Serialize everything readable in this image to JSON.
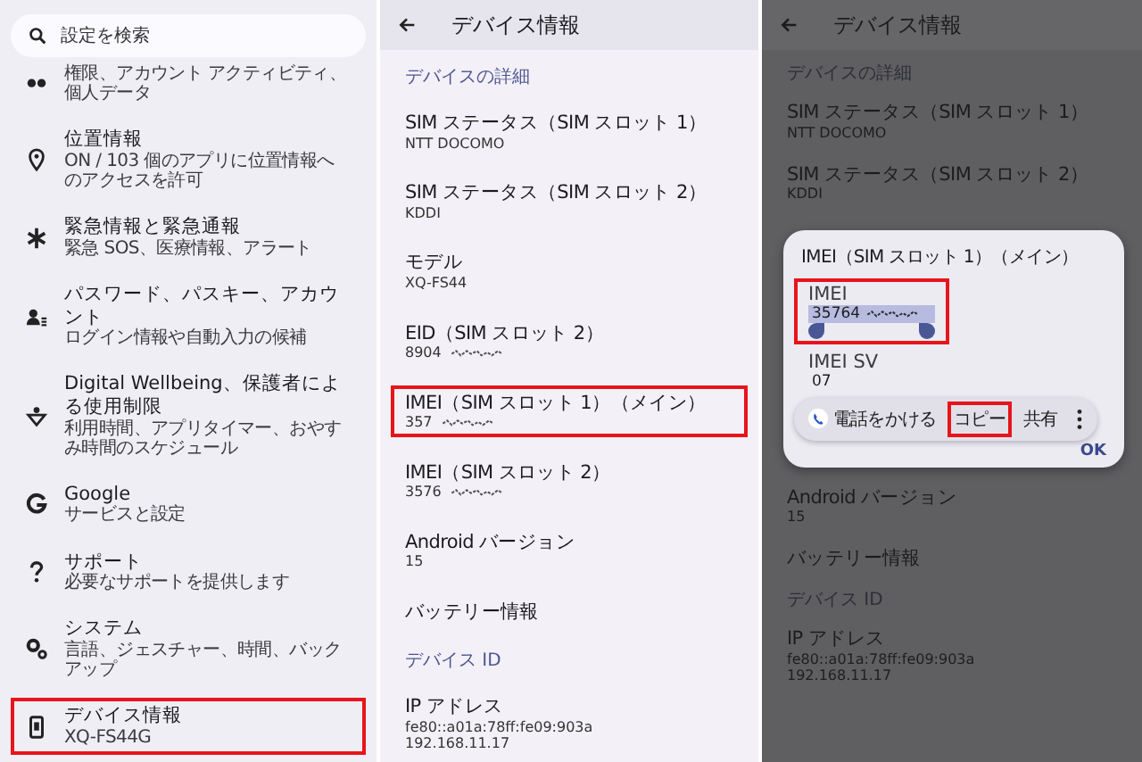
{
  "settings_panel": {
    "search": {
      "placeholder": "設定を検索"
    },
    "items": [
      {
        "subtitle": "権限、アカウント アクティビティ、個人データ",
        "highlighted": false
      },
      {
        "title": "位置情報",
        "subtitle": "ON / 103 個のアプリに位置情報へのアクセスを許可",
        "highlighted": false
      },
      {
        "title": "緊急情報と緊急通報",
        "subtitle": "緊急 SOS、医療情報、アラート",
        "highlighted": false
      },
      {
        "title": "パスワード、パスキー、アカウント",
        "subtitle": "ログイン情報や自動入力の候補",
        "highlighted": false
      },
      {
        "title": "Digital Wellbeing、保護者による使用制限",
        "subtitle": "利用時間、アプリタイマー、おやすみ時間のスケジュール",
        "highlighted": false
      },
      {
        "title": "Google",
        "subtitle": "サービスと設定",
        "highlighted": false
      },
      {
        "title": "サポート",
        "subtitle": "必要なサポートを提供します",
        "highlighted": false
      },
      {
        "title": "システム",
        "subtitle": "言語、ジェスチャー、時間、バックアップ",
        "highlighted": false
      },
      {
        "title": "デバイス情報",
        "subtitle": "XQ-FS44G",
        "highlighted": true
      }
    ]
  },
  "device_info": {
    "title": "デバイス情報",
    "items": [
      {
        "kind": "header",
        "title": "デバイスの詳細"
      },
      {
        "kind": "item",
        "title": "SIM ステータス（SIM スロット 1）",
        "values": [
          "NTT DOCOMO"
        ],
        "masked": false,
        "highlighted": false
      },
      {
        "kind": "item",
        "title": "SIM ステータス（SIM スロット 2）",
        "values": [
          "KDDI"
        ],
        "masked": false,
        "highlighted": false
      },
      {
        "kind": "item",
        "title": "モデル",
        "values": [
          "XQ-FS44"
        ],
        "masked": false,
        "highlighted": false
      },
      {
        "kind": "item",
        "title": "EID（SIM スロット 2）",
        "values": [
          "8904"
        ],
        "masked": true,
        "highlighted": false
      },
      {
        "kind": "item",
        "title": "IMEI（SIM スロット 1）（メイン）",
        "values": [
          "357"
        ],
        "masked": true,
        "highlighted": true
      },
      {
        "kind": "item",
        "title": "IMEI（SIM スロット 2）",
        "values": [
          "3576"
        ],
        "masked": true,
        "highlighted": false
      },
      {
        "kind": "item",
        "title": "Android バージョン",
        "values": [
          "15"
        ],
        "masked": false,
        "highlighted": false
      },
      {
        "kind": "item",
        "title": "バッテリー情報",
        "highlighted": false
      },
      {
        "kind": "header",
        "title": "デバイス ID"
      },
      {
        "kind": "item",
        "title": "IP アドレス",
        "values": [
          "fe80::a01a:78ff:fe09:903a",
          "192.168.11.17"
        ],
        "masked": false,
        "highlighted": false
      }
    ]
  },
  "dialog_screen": {
    "title": "デバイス情報",
    "items_above": [
      {
        "kind": "header",
        "title": "デバイスの詳細"
      },
      {
        "kind": "item",
        "title": "SIM ステータス（SIM スロット 1）",
        "values": [
          "NTT DOCOMO"
        ],
        "masked": false,
        "highlighted": false
      },
      {
        "kind": "item",
        "title": "SIM ステータス（SIM スロット 2）",
        "values": [
          "KDDI"
        ],
        "masked": false,
        "highlighted": false
      }
    ],
    "dialog": {
      "title": "IMEI（SIM スロット 1）（メイン）",
      "fields": [
        {
          "label": "IMEI",
          "value": "35764",
          "masked": true,
          "selected": true,
          "highlighted": true
        },
        {
          "label": "IMEI SV",
          "value": "07",
          "masked": false,
          "selected": false,
          "highlighted": false
        }
      ],
      "actions": [
        {
          "kind": "call",
          "label": "電話をかける",
          "highlighted": false
        },
        {
          "kind": "text",
          "label": "コピー",
          "highlighted": true
        },
        {
          "kind": "text",
          "label": "共有",
          "highlighted": false
        },
        {
          "kind": "more",
          "highlighted": false
        }
      ],
      "ok": "OK"
    },
    "items_below": [
      {
        "kind": "item",
        "title": "Android バージョン",
        "values": [
          "15"
        ],
        "masked": false,
        "highlighted": false
      },
      {
        "kind": "item",
        "title": "バッテリー情報",
        "highlighted": false
      },
      {
        "kind": "header",
        "title": "デバイス ID"
      },
      {
        "kind": "item",
        "title": "IP アドレス",
        "values": [
          "fe80::a01a:78ff:fe09:903a",
          "192.168.11.17"
        ],
        "masked": false,
        "highlighted": false
      }
    ]
  }
}
